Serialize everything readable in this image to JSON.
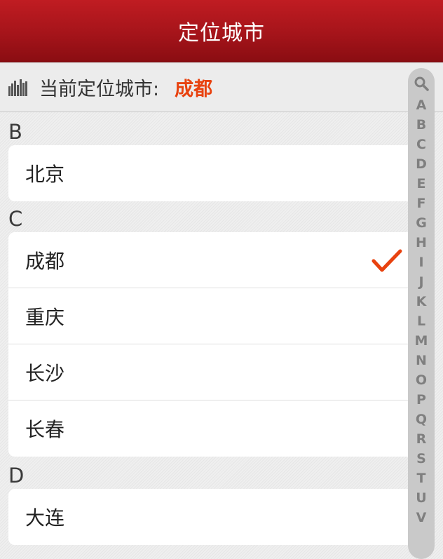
{
  "navbar": {
    "title": "定位城市"
  },
  "current": {
    "label": "当前定位城市:",
    "city": "成都"
  },
  "sections": {
    "b": {
      "letter": "B",
      "cities": [
        "北京"
      ]
    },
    "c": {
      "letter": "C",
      "cities": [
        "成都",
        "重庆",
        "长沙",
        "长春"
      ],
      "selected": "成都"
    },
    "d": {
      "letter": "D",
      "cities": [
        "大连"
      ]
    }
  },
  "index": {
    "search_icon": "search-icon",
    "letters": [
      "A",
      "B",
      "C",
      "D",
      "E",
      "F",
      "G",
      "H",
      "I",
      "J",
      "K",
      "L",
      "M",
      "N",
      "O",
      "P",
      "Q",
      "R",
      "S",
      "T",
      "U",
      "V"
    ]
  },
  "colors": {
    "nav_red": "#a5141a",
    "accent_orange": "#e8420f"
  }
}
